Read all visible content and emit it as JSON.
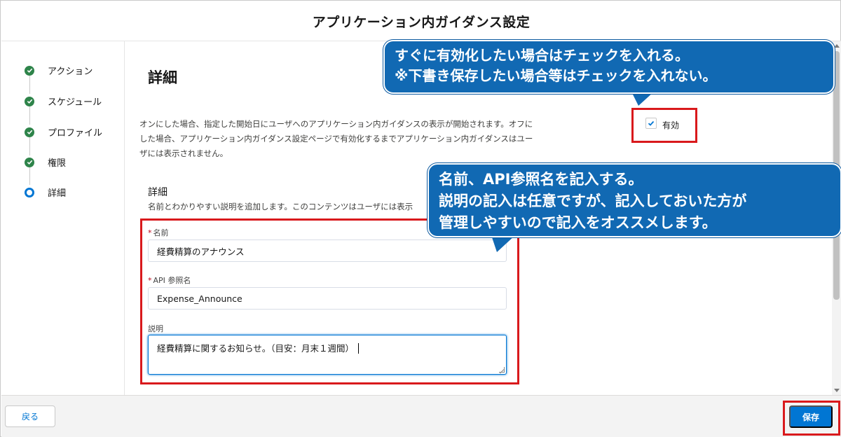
{
  "modal": {
    "title": "アプリケーション内ガイダンス設定"
  },
  "steps": [
    {
      "label": "アクション",
      "state": "complete"
    },
    {
      "label": "スケジュール",
      "state": "complete"
    },
    {
      "label": "プロファイル",
      "state": "complete"
    },
    {
      "label": "権限",
      "state": "complete"
    },
    {
      "label": "詳細",
      "state": "current"
    }
  ],
  "content": {
    "section_title": "詳細",
    "description_lines": [
      "オンにした場合、指定した開始日にユーザへのアプリケーション内ガイダンスの表示が開始されます。オフに",
      "した場合、アプリケーション内ガイダンス設定ページで有効化するまでアプリケーション内ガイダンスはユー",
      "ザには表示されません。"
    ],
    "active_checkbox": {
      "label": "有効",
      "checked": true
    },
    "subsection_title": "詳細",
    "subsection_desc": "名前とわかりやすい説明を追加します。このコンテンツはユーザには表示",
    "fields": {
      "name": {
        "required_mark": "*",
        "label": "名前",
        "value": "経費精算のアナウンス"
      },
      "api_name": {
        "required_mark": "*",
        "label": "API 参照名",
        "value": "Expense_Announce"
      },
      "description": {
        "label": "説明",
        "value": "経費精算に関するお知らせ。（目安：月末１週間）"
      }
    }
  },
  "footer": {
    "back_label": "戻る",
    "save_label": "保存"
  },
  "callouts": {
    "active": [
      "すぐに有効化したい場合はチェックを入れる。",
      "※下書き保存したい場合等はチェックを入れない。"
    ],
    "form": [
      "名前、API参照名を記入する。",
      "説明の記入は任意ですが、記入しておいた方が",
      "管理しやすいので記入をオススメします。"
    ]
  },
  "colors": {
    "brand": "#0176d3",
    "success": "#2e844a",
    "highlight": "#d9191c",
    "callout": "#1169b3"
  }
}
